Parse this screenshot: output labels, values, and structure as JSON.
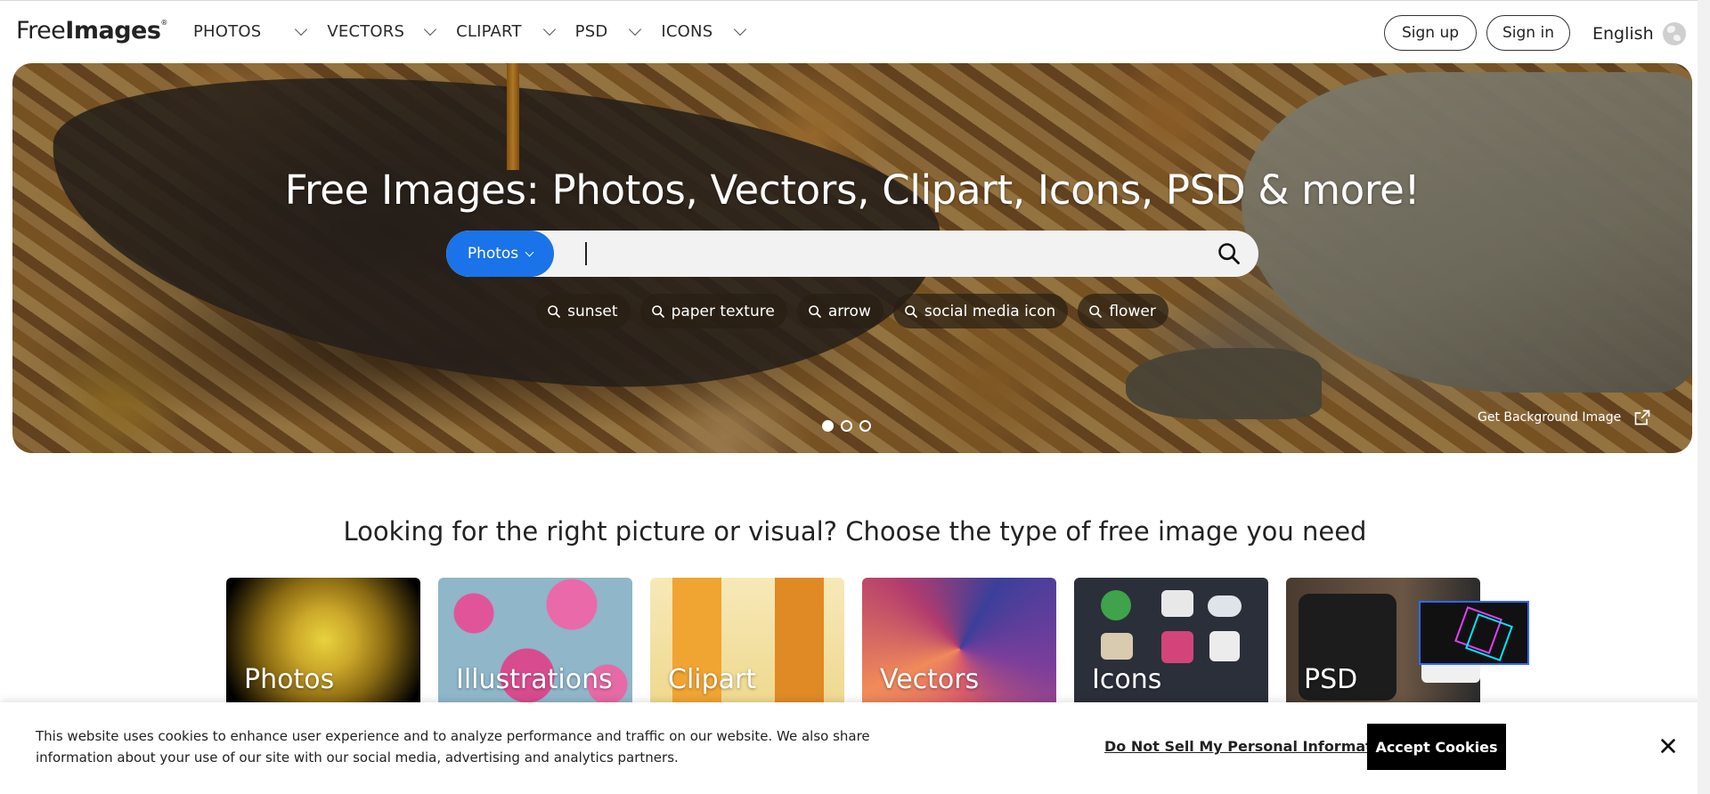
{
  "header": {
    "logo_regular": "Free",
    "logo_bold": "Images",
    "logo_mark": "®",
    "nav": [
      {
        "label": "PHOTOS"
      },
      {
        "label": "VECTORS"
      },
      {
        "label": "CLIPART"
      },
      {
        "label": "PSD"
      },
      {
        "label": "ICONS"
      }
    ],
    "signup_label": "Sign up",
    "signin_label": "Sign in",
    "language_label": "English"
  },
  "hero": {
    "title": "Free Images: Photos, Vectors, Clipart, Icons, PSD & more!",
    "search_type": "Photos",
    "search_value": "",
    "chips": [
      {
        "label": "sunset"
      },
      {
        "label": "paper texture"
      },
      {
        "label": "arrow"
      },
      {
        "label": "social media icon"
      },
      {
        "label": "flower"
      }
    ],
    "slides": 3,
    "active_slide": 1,
    "background_link": "Get Background Image"
  },
  "types": {
    "title": "Looking for the right picture or visual? Choose the type of free image you need",
    "cards": [
      {
        "label": "Photos"
      },
      {
        "label": "Illustrations"
      },
      {
        "label": "Clipart"
      },
      {
        "label": "Vectors"
      },
      {
        "label": "Icons"
      },
      {
        "label": "PSD"
      }
    ]
  },
  "cookie": {
    "text": "This website uses cookies to enhance user experience and to analyze performance and traffic on our website. We also share information about your use of our site with our social media, advertising and analytics partners.",
    "dns_label": "Do Not Sell My Personal Information",
    "accept_label": "Accept Cookies"
  },
  "colors": {
    "accent": "#1a73e8",
    "accept_bg": "#000000"
  }
}
